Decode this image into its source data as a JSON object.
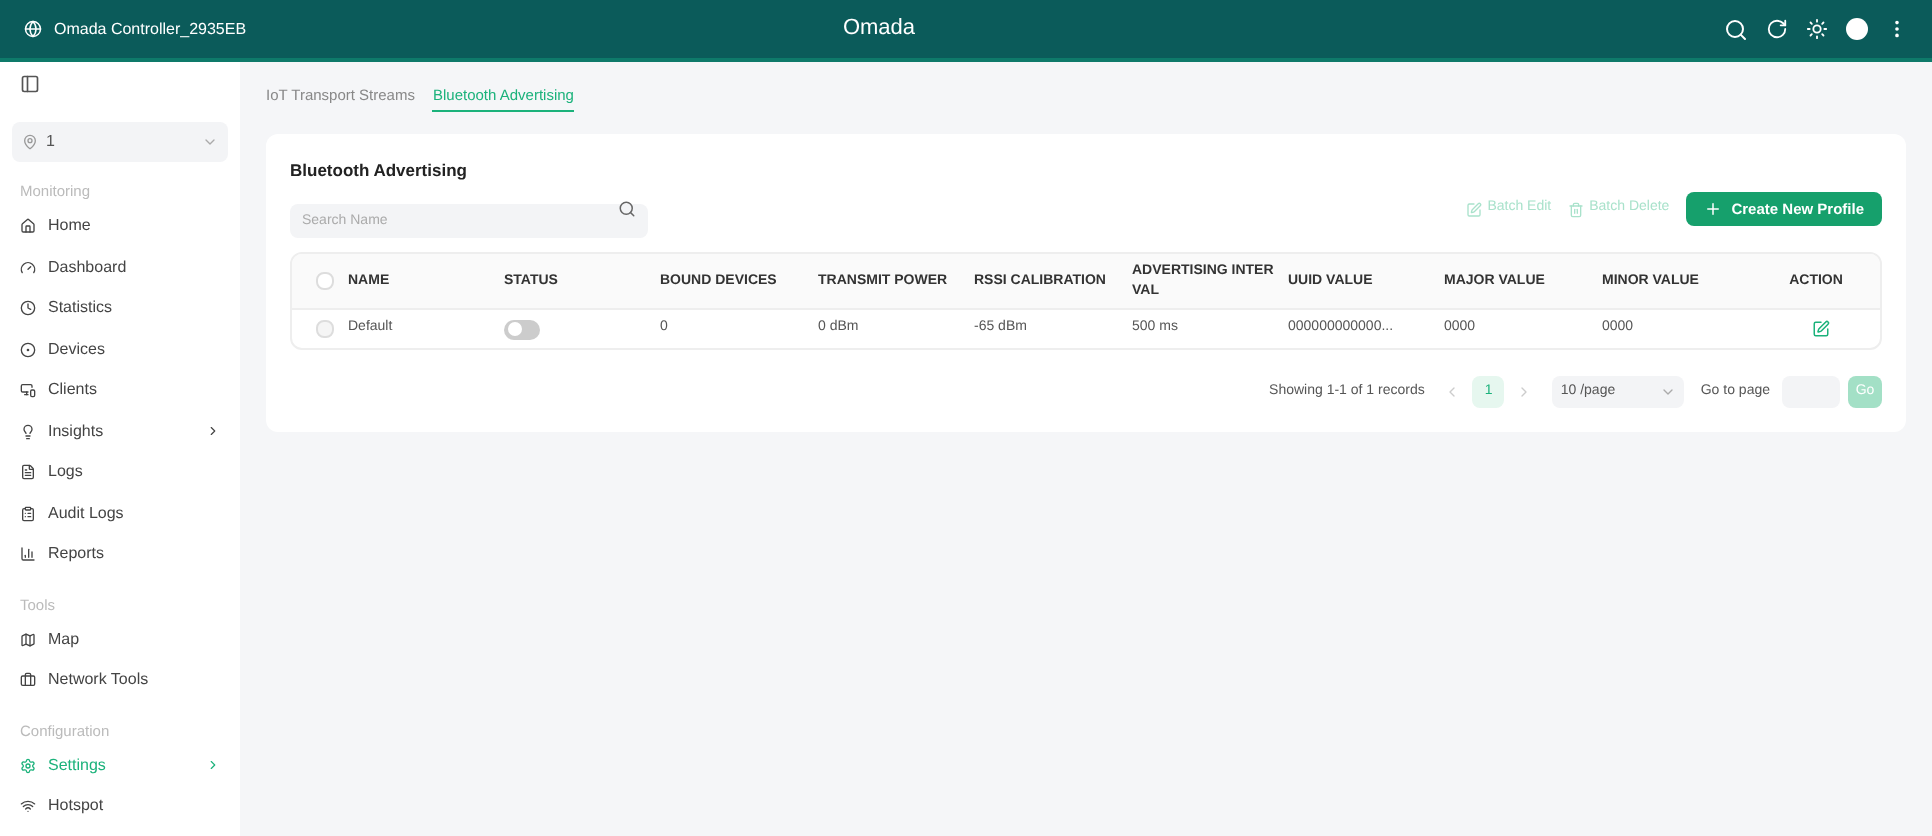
{
  "header": {
    "site_name": "Omada Controller_2935EB",
    "logo": "Omada"
  },
  "sidebar": {
    "site_selector": {
      "value": "1"
    },
    "sections": [
      {
        "title": "Monitoring",
        "items": [
          {
            "label": "Home",
            "selected": false,
            "submenu": false
          },
          {
            "label": "Dashboard",
            "selected": false,
            "submenu": false
          },
          {
            "label": "Statistics",
            "selected": false,
            "submenu": false
          },
          {
            "label": "Devices",
            "selected": false,
            "submenu": false
          },
          {
            "label": "Clients",
            "selected": false,
            "submenu": false
          },
          {
            "label": "Insights",
            "selected": false,
            "submenu": true
          },
          {
            "label": "Logs",
            "selected": false,
            "submenu": false
          },
          {
            "label": "Audit Logs",
            "selected": false,
            "submenu": false
          },
          {
            "label": "Reports",
            "selected": false,
            "submenu": false
          }
        ]
      },
      {
        "title": "Tools",
        "items": [
          {
            "label": "Map",
            "selected": false,
            "submenu": false
          },
          {
            "label": "Network Tools",
            "selected": false,
            "submenu": false
          }
        ]
      },
      {
        "title": "Configuration",
        "items": [
          {
            "label": "Settings",
            "selected": true,
            "submenu": true
          },
          {
            "label": "Hotspot",
            "selected": false,
            "submenu": false
          }
        ]
      }
    ]
  },
  "tabs": [
    {
      "label": "IoT Transport Streams",
      "selected": false
    },
    {
      "label": "Bluetooth Advertising",
      "selected": true
    }
  ],
  "panel": {
    "title": "Bluetooth Advertising",
    "search": {
      "placeholder": "Search Name"
    },
    "actions": [
      {
        "label": "Batch Edit",
        "disabled": true
      },
      {
        "label": "Batch Delete",
        "disabled": true
      }
    ],
    "create_button": "Create New Profile"
  },
  "table": {
    "select_all_checked": false,
    "columns": [
      "NAME",
      "STATUS",
      "BOUND DEVICES",
      "TRANSMIT POWER",
      "RSSI CALIBRATION",
      "ADVERTISING INTER VAL",
      "UUID VALUE",
      "MAJOR VALUE",
      "MINOR VALUE",
      "ACTION"
    ],
    "rows": [
      {
        "checked": false,
        "name": "Default",
        "status_on": false,
        "bound_devices": "0",
        "transmit_power": "0 dBm",
        "rssi_calibration": "-65 dBm",
        "advertising_interval": "500 ms",
        "uuid_value": "000000000000...",
        "major_value": "0000",
        "minor_value": "0000"
      }
    ]
  },
  "pagination": {
    "summary": "Showing 1-1 of 1 records",
    "pages": [
      {
        "label": "1",
        "selected": true
      }
    ],
    "page_size": "10 /page",
    "goto_label": "Go to page",
    "go_button": "Go"
  }
}
